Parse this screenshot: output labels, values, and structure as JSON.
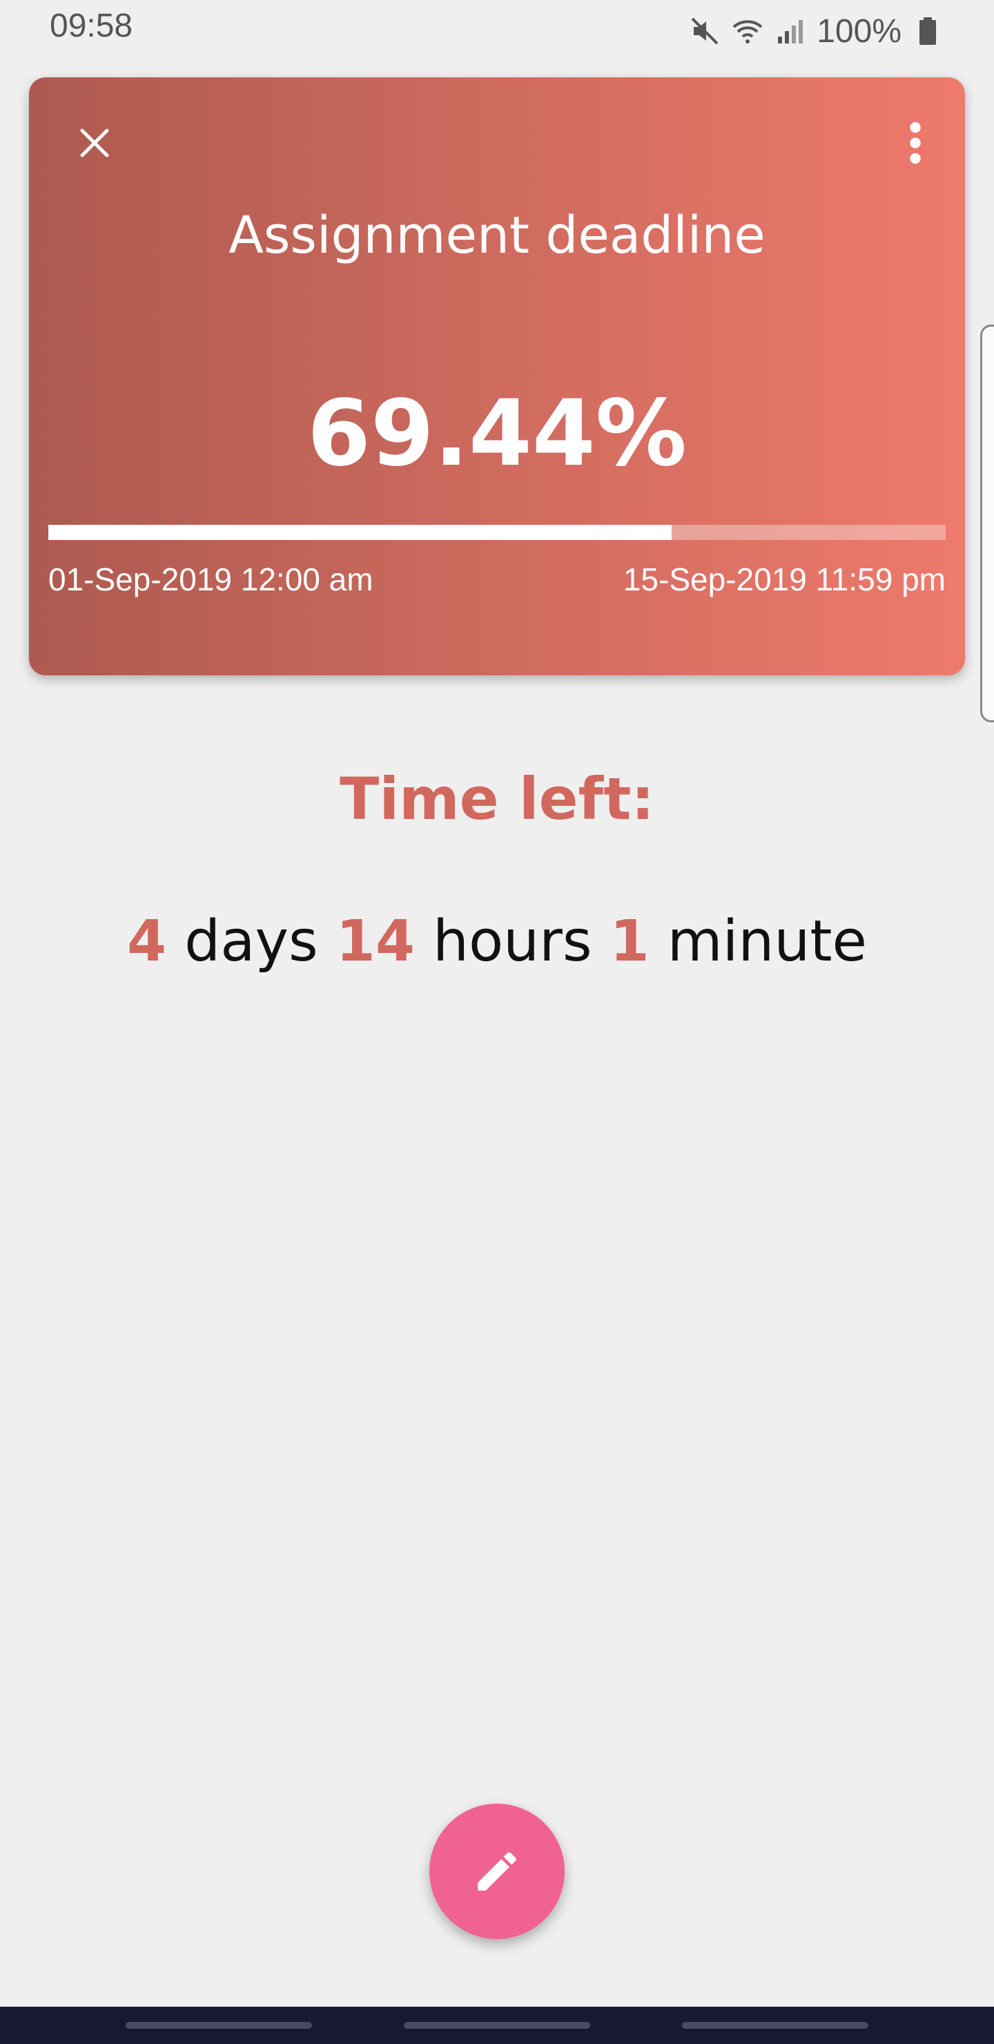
{
  "status_bar": {
    "time": "09:58",
    "battery_text": "100%",
    "icons": [
      "mute-icon",
      "wifi-icon",
      "signal-icon",
      "battery-icon"
    ]
  },
  "card": {
    "title": "Assignment deadline",
    "percent_text": "69.44%",
    "progress_value": 0.6944,
    "start_date": "01-Sep-2019 12:00 am",
    "end_date": "15-Sep-2019 11:59 pm",
    "gradient_start": "#ad5a50",
    "gradient_end": "#ee7a6c",
    "icons": {
      "close": "close-icon",
      "more": "more-vert-icon"
    }
  },
  "time_left": {
    "label": "Time left:",
    "days_value": "4",
    "days_unit": "days",
    "hours_value": "14",
    "hours_unit": "hours",
    "minutes_value": "1",
    "minutes_unit": "minute",
    "accent_color": "#d1685e"
  },
  "fab": {
    "icon": "edit-pencil-icon",
    "color": "#f06292"
  }
}
